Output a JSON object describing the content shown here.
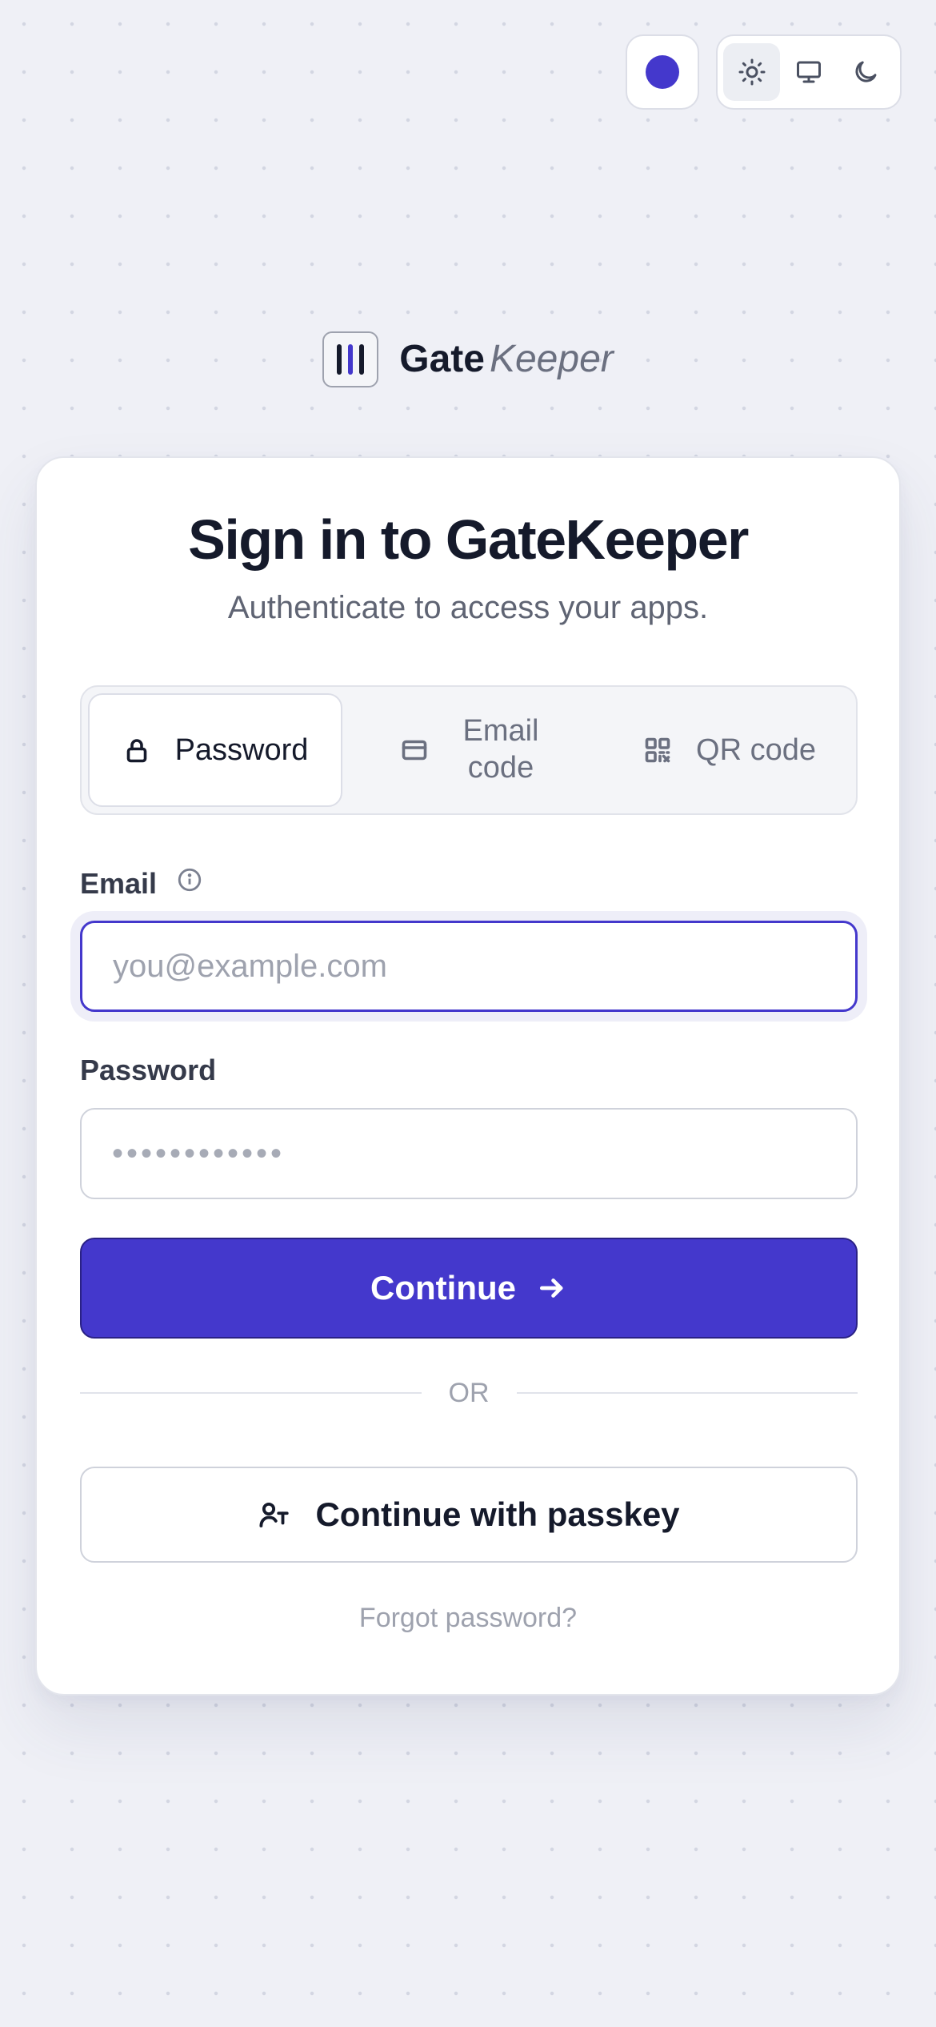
{
  "colors": {
    "accent": "#4438cc",
    "background": "#eff0f6",
    "text_primary": "#151a2b",
    "text_muted": "#5f6473"
  },
  "top_controls": {
    "accent_swatch_icon": "accent-color-dot",
    "theme_options": [
      {
        "icon": "sun-icon",
        "active": true
      },
      {
        "icon": "monitor-icon",
        "active": false
      },
      {
        "icon": "moon-icon",
        "active": false
      }
    ]
  },
  "brand": {
    "logo_icon": "three-bars-logo-icon",
    "name_bold": "Gate",
    "name_italic": "Keeper"
  },
  "signin": {
    "title": "Sign in to GateKeeper",
    "subtitle": "Authenticate to access your apps.",
    "tabs": [
      {
        "label": "Password",
        "icon": "lock-icon",
        "active": true
      },
      {
        "label": "Email code",
        "icon": "card-icon",
        "active": false
      },
      {
        "label": "QR code",
        "icon": "qr-code-icon",
        "active": false
      }
    ],
    "email_label": "Email",
    "email_info_icon": "info-icon",
    "email_placeholder": "you@example.com",
    "email_value": "",
    "password_label": "Password",
    "password_mask": "••••••••••••",
    "continue_label": "Continue",
    "continue_icon": "arrow-right-icon",
    "divider_text": "OR",
    "passkey_label": "Continue with passkey",
    "passkey_icon": "passkey-icon",
    "forgot_label": "Forgot password?"
  }
}
